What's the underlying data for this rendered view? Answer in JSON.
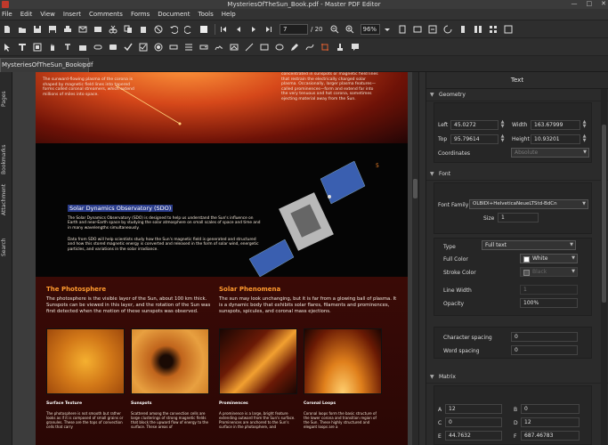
{
  "window": {
    "title": "MysteriesOfTheSun_Book.pdf - Master PDF Editor",
    "min": "—",
    "max": "□",
    "close": "✕"
  },
  "menu": [
    "File",
    "Edit",
    "View",
    "Insert",
    "Comments",
    "Forms",
    "Document",
    "Tools",
    "Help"
  ],
  "toolbar": {
    "page_current": "7",
    "page_total": "/ 20",
    "zoom": "96%"
  },
  "tab": {
    "label": "MysteriesOfTheSun_Book.pdf",
    "close": "✕"
  },
  "sidebar_tabs": [
    "Pages",
    "Bookmarks",
    "Attachment",
    "Search"
  ],
  "doc": {
    "top_left_text": "The sunward-flowing plasma of the corona is shaped by magnetic field lines into tapered forms called coronal streamers, which extend millions of miles into space.",
    "top_right_text": "concentrated in sunspots or magnetic field lines that restrain the electrically charged solar plasma. Occasionally, larger plasma features—called prominences—form and extend far into the very tenuous and hot corona, sometimes ejecting material away from the Sun.",
    "page_num": "5",
    "sdo_title": "Solar Dynamics Observatory (SDO)",
    "sdo_p1": "The Solar Dynamics Observatory (SDO) is designed to help us understand the Sun's influence on Earth and near-Earth space by studying the solar atmosphere on small scales of space and time and in many wavelengths simultaneously.",
    "sdo_p2": "Data from SDO will help scientists study how the Sun's magnetic field is generated and structured and how this stored magnetic energy is converted and released in the form of solar wind, energetic particles, and variations in the solar irradiance.",
    "photosphere_title": "The Photosphere",
    "photosphere_text": "The photosphere is the visible layer of the Sun, about 100 km thick. Sunspots can be viewed in this layer, and the rotation of the Sun was first detected when the motion of these sunspots was observed.",
    "phenomena_title": "Solar Phenomena",
    "phenomena_text": "The sun may look unchanging, but it is far from a glowing ball of plasma. It is a dynamic body that exhibits solar flares, filaments and prominences, sunspots, spicules, and coronal mass ejections.",
    "photos": [
      {
        "caption": "Surface Texture",
        "text": "The photosphere is not smooth but rather looks as if it is composed of small grains or granules. These are the tops of convection cells that carry"
      },
      {
        "caption": "Sunspots",
        "text": "Scattered among the convection cells are large clusterings of strong magnetic fields that block the upward flow of energy to the surface. These areas of"
      },
      {
        "caption": "Prominences",
        "text": "A prominence is a large, bright feature extending outward from the Sun's surface. Prominences are anchored to the Sun's surface in the photosphere, and"
      },
      {
        "caption": "Coronal Loops",
        "text": "Coronal loops form the basic structure of the lower corona and transition region of the Sun. These highly structured and elegant loops are a"
      }
    ]
  },
  "panel": {
    "title": "Text",
    "geometry": "Geometry",
    "left_label": "Left",
    "left_value": "45.0272",
    "width_label": "Width",
    "width_value": "163.67999",
    "top_label": "Top",
    "top_value": "95.79614",
    "height_label": "Height",
    "height_value": "10.93201",
    "coords_label": "Coordinates",
    "coords_value": "Absolute",
    "font": "Font",
    "font_family_label": "Font Family",
    "font_family_value": "OLBIDI+HelveticaNeueLTStd-BdCn",
    "size_label": "Size",
    "size_value": "1",
    "type_label": "Type",
    "type_value": "Full text",
    "fill_label": "Full Color",
    "fill_value": "White",
    "stroke_label": "Stroke Color",
    "stroke_value": "Black",
    "linewidth_label": "Line Width",
    "linewidth_value": "1",
    "opacity_label": "Opacity",
    "opacity_value": "100%",
    "charspacing_label": "Character spacing",
    "charspacing_value": "0",
    "wordspacing_label": "Word spacing",
    "wordspacing_value": "0",
    "matrix": "Matrix",
    "a_label": "A",
    "a_value": "12",
    "b_label": "B",
    "b_value": "0",
    "c_label": "C",
    "c_value": "0",
    "d_label": "D",
    "d_value": "12",
    "e_label": "E",
    "e_value": "44.7632",
    "f_label": "F",
    "f_value": "687.46783"
  },
  "colors": {
    "accent": "#ff9a2e",
    "panel_bg": "#2b2b2b",
    "sdo_highlight": "#2a3c8a"
  }
}
